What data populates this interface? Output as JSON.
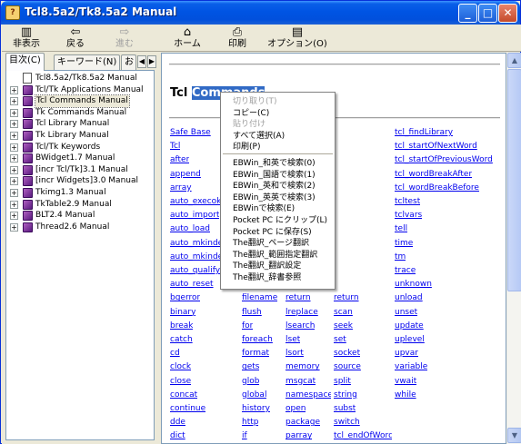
{
  "window": {
    "title": "Tcl8.5a2/Tk8.5a2 Manual",
    "icon": "help-book-icon"
  },
  "toolbar": [
    {
      "label": "非表示",
      "icon": "hide-icon",
      "glyph": "▥",
      "enabled": true
    },
    {
      "label": "戻る",
      "icon": "back-arrow-icon",
      "glyph": "⇦",
      "enabled": true
    },
    {
      "label": "進む",
      "icon": "forward-arrow-icon",
      "glyph": "⇨",
      "enabled": false
    },
    {
      "label": "ホーム",
      "icon": "home-icon",
      "glyph": "⌂",
      "enabled": true
    },
    {
      "label": "印刷",
      "icon": "printer-icon",
      "glyph": "⎙",
      "enabled": true
    },
    {
      "label": "オプション(O)",
      "icon": "options-icon",
      "glyph": "▤",
      "enabled": true
    }
  ],
  "tabs": [
    "目次(C)",
    "キーワード(N)",
    "お"
  ],
  "tree": [
    {
      "label": "Tcl8.5a2/Tk8.5a2 Manual",
      "type": "doc"
    },
    {
      "label": "Tcl/Tk Applications Manual",
      "type": "book"
    },
    {
      "label": "Tcl Commands Manual",
      "type": "book",
      "selected": true
    },
    {
      "label": "Tk Commands Manual",
      "type": "book"
    },
    {
      "label": "Tcl Library Manual",
      "type": "book"
    },
    {
      "label": "Tk Library Manual",
      "type": "book"
    },
    {
      "label": "Tcl/Tk Keywords",
      "type": "book"
    },
    {
      "label": "BWidget1.7 Manual",
      "type": "book"
    },
    {
      "label": "[incr Tcl/Tk]3.1 Manual",
      "type": "book"
    },
    {
      "label": "[incr Widgets]3.0 Manual",
      "type": "book"
    },
    {
      "label": "Tkimg1.3 Manual",
      "type": "book"
    },
    {
      "label": "TkTable2.9 Manual",
      "type": "book"
    },
    {
      "label": "BLT2.4 Manual",
      "type": "book"
    },
    {
      "label": "Thread2.6 Manual",
      "type": "book"
    }
  ],
  "content": {
    "heading_prefix": "Tcl ",
    "heading_selected": "Commands",
    "columns": [
      [
        "Safe Base",
        "Tcl",
        "after",
        "append",
        "array",
        "auto_execok",
        "auto_import",
        "auto_load",
        "auto_mkindex",
        "auto_mkindex",
        "auto_qualify",
        "auto_reset",
        "bgerror",
        "binary",
        "break",
        "catch",
        "cd",
        "clock",
        "close",
        "concat",
        "continue",
        "dde",
        "dict"
      ],
      [
        "",
        "",
        "",
        "",
        "",
        "",
        "",
        "",
        "",
        "",
        "",
        "",
        "filename",
        "flush",
        "for",
        "foreach",
        "format",
        "gets",
        "glob",
        "global",
        "history",
        "http",
        "if"
      ],
      [
        "pid",
        "pkg::create",
        "pkg_mkIndex",
        "proc",
        "puts",
        "pwd",
        "re_syntax",
        "read",
        "regexp",
        "registry",
        "regsub",
        "rename",
        "return",
        "lreplace",
        "lsearch",
        "lset",
        "lsort",
        "memory",
        "msgcat",
        "namespace",
        "open",
        "package",
        "parray"
      ],
      [
        "",
        "",
        "",
        "",
        "",
        "",
        "",
        "",
        "",
        "",
        "",
        "",
        "return",
        "scan",
        "seek",
        "set",
        "socket",
        "source",
        "split",
        "string",
        "subst",
        "switch",
        "tcl_endOfWord"
      ],
      [
        "tcl_findLibrary",
        "tcl_startOfNextWord",
        "tcl_startOfPreviousWord",
        "tcl_wordBreakAfter",
        "tcl_wordBreakBefore",
        "tcltest",
        "tclvars",
        "tell",
        "time",
        "tm",
        "trace",
        "unknown",
        "unload",
        "unset",
        "update",
        "uplevel",
        "upvar",
        "variable",
        "vwait",
        "while",
        "",
        "",
        ""
      ]
    ]
  },
  "context_menu": [
    {
      "label": "切り取り(T)",
      "enabled": false
    },
    {
      "label": "コピー(C)",
      "enabled": true
    },
    {
      "label": "貼り付け",
      "enabled": false
    },
    {
      "label": "すべて選択(A)",
      "enabled": true
    },
    {
      "label": "印刷(P)",
      "enabled": true
    },
    {
      "separator": true
    },
    {
      "label": "EBWin_和英で検索(0)",
      "enabled": true
    },
    {
      "label": "EBWin_国語で検索(1)",
      "enabled": true
    },
    {
      "label": "EBWin_英和で検索(2)",
      "enabled": true
    },
    {
      "label": "EBWin_英英で検索(3)",
      "enabled": true
    },
    {
      "label": "EBWinで検索(E)",
      "enabled": true
    },
    {
      "label": "Pocket PC にクリップ(L)",
      "enabled": true
    },
    {
      "label": "Pocket PC に保存(S)",
      "enabled": true
    },
    {
      "label": "The翻訳_ページ翻訳",
      "enabled": true
    },
    {
      "label": "The翻訳_範囲指定翻訳",
      "enabled": true
    },
    {
      "label": "The翻訳_翻訳設定",
      "enabled": true
    },
    {
      "label": "The翻訳_辞書参照",
      "enabled": true
    }
  ],
  "colors": {
    "link": "#0000ee",
    "selection": "#316ac5",
    "titlebar": "#0054e3"
  }
}
